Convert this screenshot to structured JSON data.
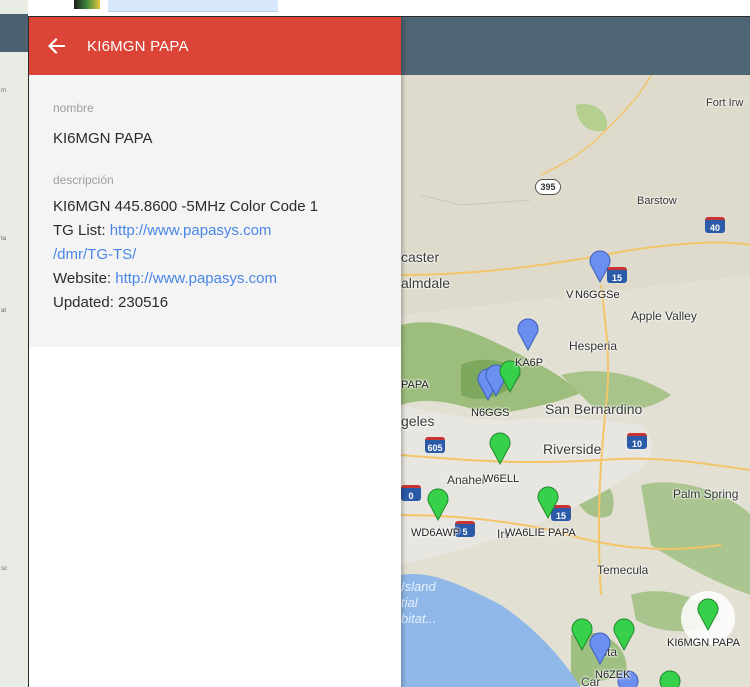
{
  "panel": {
    "title": "KI6MGN PAPA",
    "name_label": "nombre",
    "name_value": "KI6MGN PAPA",
    "description_label": "descripción",
    "description": {
      "line1": "KI6MGN 445.8600 -5MHz Color Code 1",
      "tg_prefix": "TG List: ",
      "tg_link_line1": "http://www.papasys.com",
      "tg_link_line2": "/dmr/TG-TS/",
      "website_prefix": "Website: ",
      "website_link": "http://www.papasys.com",
      "updated": "Updated: 230516"
    },
    "colors": {
      "header": "#db4437",
      "link": "#4a86e8",
      "body_bg": "#f4f4f4"
    }
  },
  "map": {
    "places": {
      "fort_irwin": "Fort Irw",
      "barstow": "Barstow",
      "lancaster": "caster",
      "palmdale": "almdale",
      "apple_valley": "Apple Valley",
      "hesperia": "Hesperia",
      "san_bernardino": "San Bernardino",
      "los_angeles": "geles",
      "riverside": "Riverside",
      "anaheim": "Anahei",
      "irvine": "Irv",
      "palm_springs": "Palm Spring",
      "temecula": "Temecula",
      "island": "Island",
      "atial": "tial",
      "bitat": "bitat...",
      "sta": "sta",
      "car": "Car",
      "papa_left": "PAPA"
    },
    "highways": {
      "h395": "395",
      "h40": "40",
      "h15a": "15",
      "h605": "605",
      "h10": "10",
      "h10b": "0",
      "h15b": "15",
      "h5": "5"
    },
    "stations": {
      "n6ggse": "N6GGSe",
      "v_prefix": "V",
      "ka6p": "KA6P",
      "n6ggs": "N6GGS",
      "w6ell": "W6ELL",
      "wd6awp": "WD6AWP",
      "wa6lie": "WA6LIE PAPA",
      "ki6mgn": "KI6MGN PAPA",
      "n6zek": "N6ZEK"
    },
    "colors": {
      "green_marker": "#37d04a",
      "blue_marker": "#6a8ff0",
      "topbar": "#4e6573"
    }
  },
  "background_strip": {
    "texts": [
      "m",
      "ta",
      "at",
      "sc"
    ]
  }
}
